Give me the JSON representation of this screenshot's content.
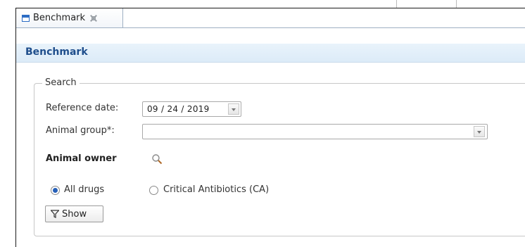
{
  "tab": {
    "label": "Benchmark"
  },
  "header": {
    "title": "Benchmark"
  },
  "search": {
    "legend": "Search",
    "reference_date_label": "Reference date:",
    "reference_date_value": "09 / 24 / 2019",
    "animal_group_label": "Animal group*:",
    "animal_group_value": "",
    "animal_owner_label": "Animal owner",
    "radio_all_drugs": "All drugs",
    "radio_critical": "Critical Antibiotics (CA)",
    "selected_radio": "All drugs",
    "show_button": "Show"
  },
  "icons": {
    "tab": "window-icon",
    "close": "close-icon",
    "search": "search-icon",
    "filter": "filter-icon",
    "dropdown": "chevron-down-icon"
  },
  "colors": {
    "accent": "#1f4e8c",
    "header_bg": "#e3eff9",
    "radio_selected": "#2660b8"
  }
}
